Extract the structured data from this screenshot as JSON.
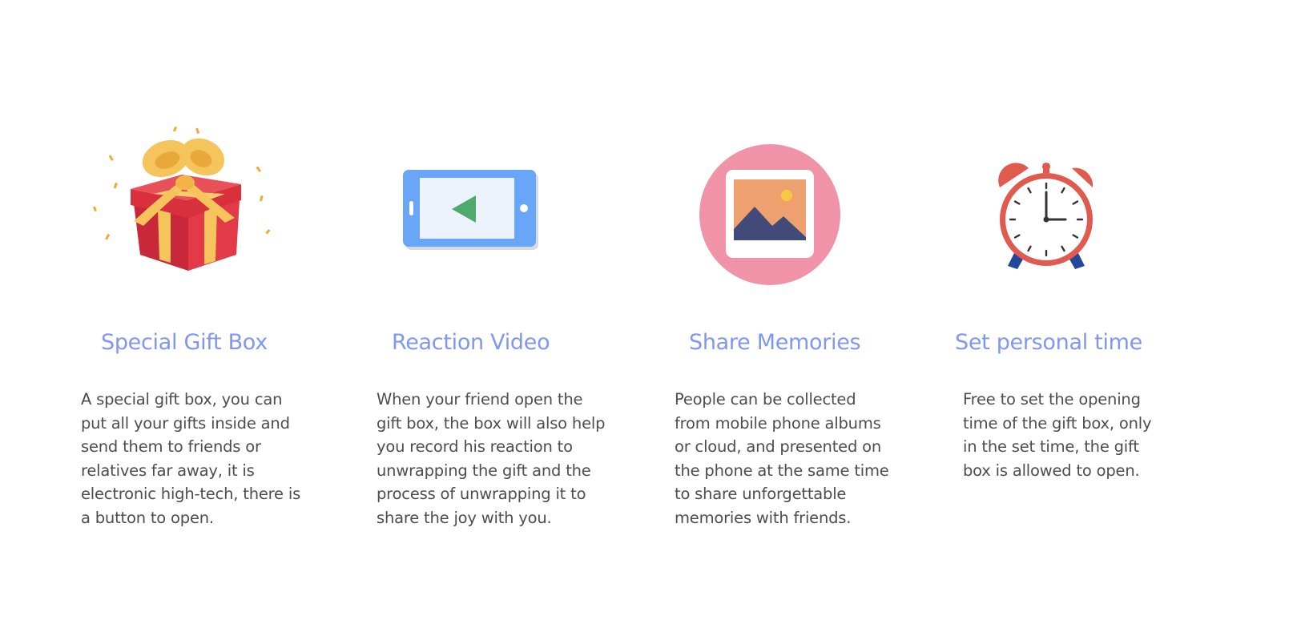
{
  "features": [
    {
      "title": "Special Gift Box",
      "icon": "gift-box-icon",
      "lines": [
        "A special gift box, you can",
        "put all your gifts inside and",
        "send them to friends or",
        "relatives far away, it is",
        "electronic high-tech, there is",
        "a button to open."
      ]
    },
    {
      "title": "Reaction Video",
      "icon": "phone-video-icon",
      "lines": [
        "When your friend open the",
        "gift box, the box will also help",
        "you record his reaction to",
        "unwrapping the gift and the",
        "process of unwrapping it to",
        "share the joy with you."
      ]
    },
    {
      "title": "Share Memories",
      "icon": "photo-icon",
      "lines": [
        "People can be collected",
        "from mobile phone albums",
        "or cloud, and presented on",
        "the phone at the same time",
        "to share unforgettable",
        "memories with friends."
      ]
    },
    {
      "title": "Set personal time",
      "icon": "alarm-clock-icon",
      "lines": [
        "Free to set the opening",
        "time of the gift box, only",
        "in the set time, the gift",
        "box is allowed to open."
      ]
    }
  ],
  "colors": {
    "title": "#7f97f1",
    "body_text": "#4d4d4d",
    "gift_red": "#d9303e",
    "ribbon_gold": "#f6c45c",
    "phone_blue": "#6aa6f8",
    "play_green": "#4faa6e",
    "photo_pink": "#f193a8",
    "clock_red": "#e05a4e"
  }
}
